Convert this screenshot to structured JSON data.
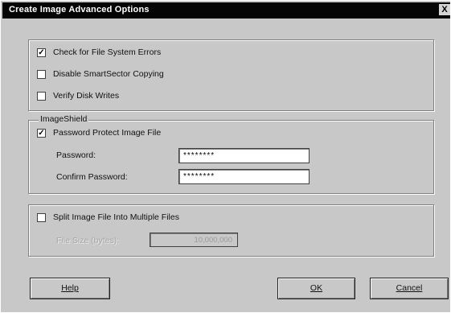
{
  "window": {
    "title": "Create Image Advanced Options",
    "close_glyph": "X"
  },
  "options": {
    "check_errors": {
      "label": "Check for File System Errors",
      "checked": true
    },
    "disable_smartsector": {
      "label": "Disable SmartSector Copying",
      "checked": false
    },
    "verify_writes": {
      "label": "Verify Disk Writes",
      "checked": false
    }
  },
  "imageshield": {
    "group_label": "ImageShield",
    "password_protect": {
      "label": "Password Protect Image File",
      "checked": true
    },
    "password_label": "Password:",
    "password_value": "********",
    "confirm_label": "Confirm Password:",
    "confirm_value": "********"
  },
  "split": {
    "label": "Split Image File Into Multiple Files",
    "checked": false,
    "filesize_label": "File Size (bytes):",
    "filesize_value": "10,000,000"
  },
  "buttons": {
    "help": "Help",
    "ok": "OK",
    "cancel": "Cancel"
  },
  "check_glyph": "✓"
}
